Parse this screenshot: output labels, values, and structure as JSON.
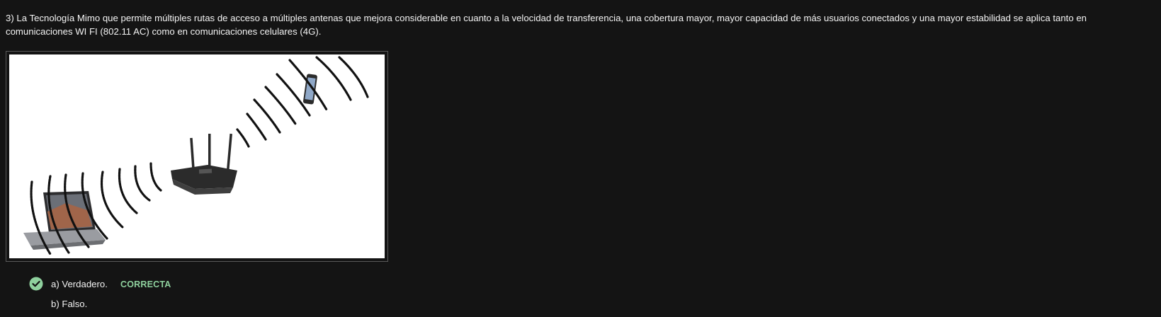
{
  "question": {
    "text": "3) La Tecnología Mimo que permite múltiples rutas de acceso a múltiples antenas que mejora considerable en cuanto a la velocidad de transferencia, una cobertura mayor, mayor capacidad de más usuarios conectados y una mayor estabilidad se aplica tanto en comunicaciones WI FI (802.11 AC) como en comunicaciones celulares (4G)."
  },
  "figure": {
    "depicts": [
      "laptop",
      "router",
      "smartphone",
      "wireless-signal-waves"
    ]
  },
  "options": [
    {
      "label": "a) Verdadero.",
      "selected": true,
      "status": "CORRECTA"
    },
    {
      "label": "b) Falso.",
      "selected": false
    }
  ],
  "colors": {
    "background": "#141414",
    "text": "#f2f2f2",
    "correct": "#8fd19e",
    "check_fill": "#8fd19e"
  },
  "icons": {
    "selected_marker": "check-circle-icon"
  }
}
